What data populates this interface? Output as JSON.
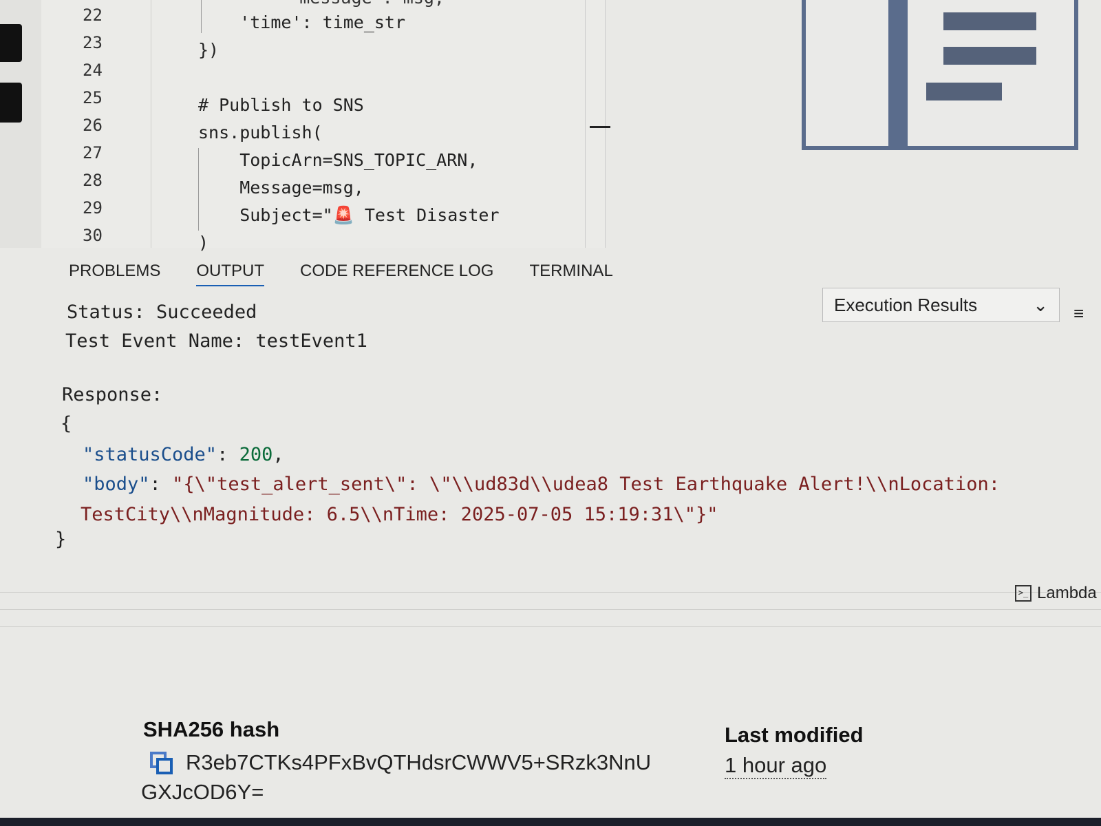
{
  "editor": {
    "lines": [
      {
        "n": "22",
        "code": "    'time': time_str",
        "top": 0
      },
      {
        "n": "23",
        "code": "})"
      },
      {
        "n": "24",
        "code": ""
      },
      {
        "n": "25",
        "code": "# Publish to SNS"
      },
      {
        "n": "26",
        "code": "sns.publish("
      },
      {
        "n": "27",
        "code": "    TopicArn=SNS_TOPIC_ARN,"
      },
      {
        "n": "28",
        "code": "    Message=msg,"
      },
      {
        "n": "29",
        "code": "    Subject=\"🚨 Test Disaster"
      },
      {
        "n": "30",
        "code": ")"
      }
    ],
    "partial_line": "    'message': msg,"
  },
  "panel": {
    "tabs": [
      "PROBLEMS",
      "OUTPUT",
      "CODE REFERENCE LOG",
      "TERMINAL"
    ],
    "active_tab": "OUTPUT",
    "output_select": "Execution Results",
    "status": "Status: Succeeded",
    "test_event": "Test Event Name: testEvent1",
    "response_label": "Response:",
    "open_brace": "{",
    "close_brace": "}",
    "status_key": "\"statusCode\"",
    "status_value": "200",
    "body_key": "\"body\"",
    "body_value_1": "\"{\\\"test_alert_sent\\\": \\\"\\\\ud83d\\\\udea8 Test Earthquake Alert!\\\\nLocation:",
    "body_value_2": "TestCity\\\\nMagnitude: 6.5\\\\nTime: 2025-07-05 15:19:31\\\"}\""
  },
  "footer_badge": "Lambda",
  "details": {
    "sha_label": "SHA256 hash",
    "sha_value_1": "R3eb7CTKs4PFxBvQTHdsrCWWV5+SRzk3NnU",
    "sha_value_2": "GXJcOD6Y=",
    "modified_label": "Last modified",
    "modified_value": "1 hour ago"
  }
}
